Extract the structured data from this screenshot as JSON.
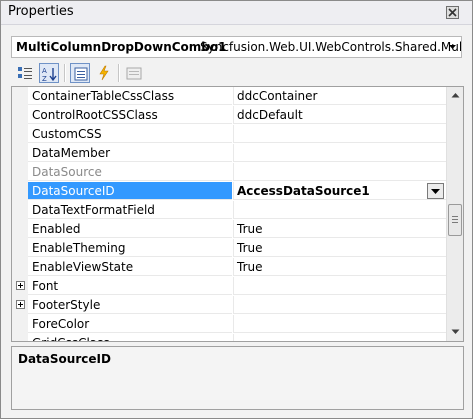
{
  "window": {
    "title": "Properties"
  },
  "selector": {
    "object_name": "MultiColumnDropDownCombo1",
    "object_type": "Syncfusion.Web.UI.WebControls.Shared.MultiC"
  },
  "toolbar": {
    "buttons": [
      "categorized-icon",
      "alphabetical-icon",
      "properties-icon",
      "events-icon",
      "property-pages-icon"
    ],
    "active": [
      "alphabetical-icon",
      "properties-icon"
    ]
  },
  "grid": {
    "rows": [
      {
        "name": "ContainerTableCssClass",
        "value": "ddcContainer"
      },
      {
        "name": "ControlRootCSSClass",
        "value": "ddcDefault"
      },
      {
        "name": "CustomCSS",
        "value": ""
      },
      {
        "name": "DataMember",
        "value": ""
      },
      {
        "name": "DataSource",
        "value": ""
      },
      {
        "name": "DataSourceID",
        "value": "AccessDataSource1"
      },
      {
        "name": "DataTextFormatField",
        "value": ""
      },
      {
        "name": "Enabled",
        "value": "True"
      },
      {
        "name": "EnableTheming",
        "value": "True"
      },
      {
        "name": "EnableViewState",
        "value": "True"
      },
      {
        "name": "Font",
        "value": ""
      },
      {
        "name": "FooterStyle",
        "value": ""
      },
      {
        "name": "ForeColor",
        "value": ""
      },
      {
        "name": "GridCssClass",
        "value": ""
      }
    ],
    "selected_row": "DataSourceID",
    "disabled_row": "DataSource",
    "expandable_rows": [
      "Font",
      "FooterStyle"
    ],
    "selection_color": "#3399ff"
  },
  "description": {
    "title": "DataSourceID"
  }
}
